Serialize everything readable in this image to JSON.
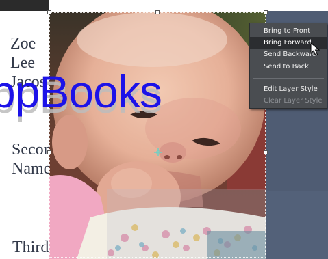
{
  "document": {
    "names": [
      "Zoe",
      "Lee",
      "Jacos"
    ],
    "second_name_lines": [
      "Secon",
      "Name"
    ],
    "third_name": "Third"
  },
  "overlay_title": "ppBooks",
  "context_menu": {
    "items": [
      {
        "label": "Bring to Front",
        "state": "normal"
      },
      {
        "label": "Bring Forward",
        "state": "active"
      },
      {
        "label": "Send Backward",
        "state": "normal"
      },
      {
        "label": "Send to Back",
        "state": "normal"
      },
      {
        "label": "Edit Layer Style",
        "state": "normal"
      },
      {
        "label": "Clear Layer Style",
        "state": "disabled"
      }
    ]
  },
  "colors": {
    "title_blue": "#1c12e8",
    "menu_bg": "#4a4d51",
    "panel_slate": "#4f5c73"
  },
  "icons": [
    "cursor-arrow-icon",
    "center-point-icon"
  ]
}
